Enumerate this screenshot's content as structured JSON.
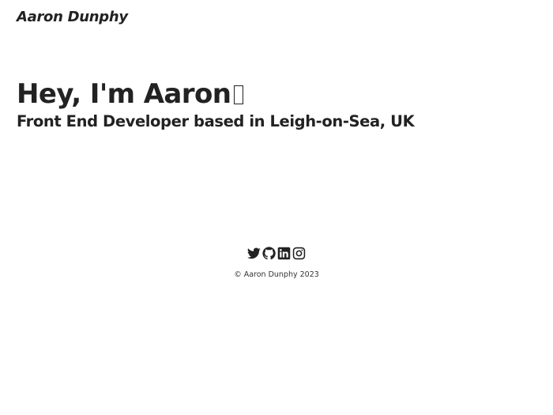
{
  "header": {
    "brand": "Aaron Dunphy"
  },
  "hero": {
    "title": "Hey, I'm Aaron",
    "subtitle": "Front End Developer based in Leigh-on-Sea, UK"
  },
  "socials": [
    {
      "icon": "twitter-icon"
    },
    {
      "icon": "github-icon"
    },
    {
      "icon": "linkedin-icon"
    },
    {
      "icon": "instagram-icon"
    }
  ],
  "footer": {
    "copyright": "© Aaron Dunphy 2023"
  }
}
